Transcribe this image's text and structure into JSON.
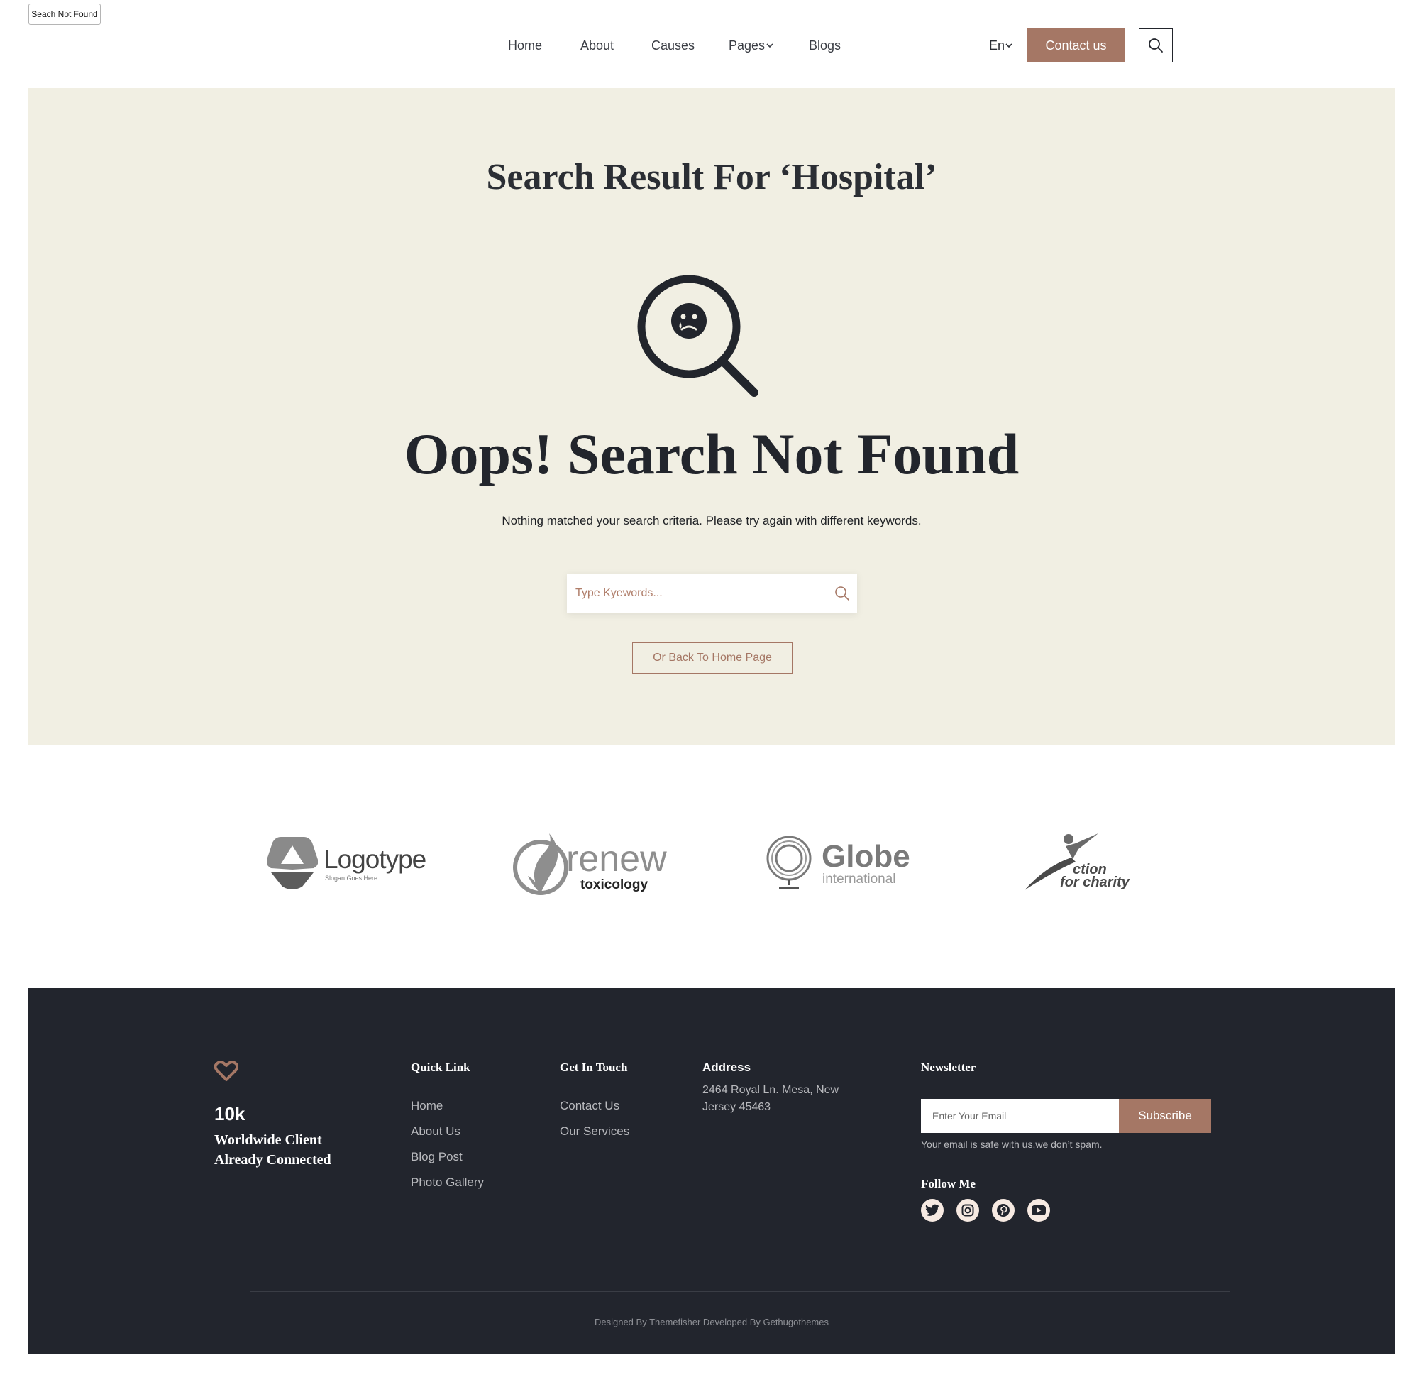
{
  "page_label": "Seach Not Found",
  "header": {
    "nav": [
      {
        "label": "Home"
      },
      {
        "label": "About"
      },
      {
        "label": "Causes"
      },
      {
        "label": "Pages"
      },
      {
        "label": "Blogs"
      }
    ],
    "language": "En",
    "contact_label": "Contact us"
  },
  "hero": {
    "title": "Search Result For ‘Hospital’",
    "heading": "Oops! Search Not Found",
    "text": "Nothing matched your search criteria. Please try again with different keywords.",
    "search_placeholder": "Type Kyewords...",
    "back_label": "Or Back To Home Page"
  },
  "logos": {
    "logotype": {
      "name": "Logotype",
      "slogan": "Slogan Goes Here"
    },
    "renew": {
      "name": "renew",
      "sub": "toxicology"
    },
    "globe": {
      "name": "Globe",
      "sub": "international"
    },
    "charity": {
      "line1": "ction",
      "line2": "for charity"
    }
  },
  "footer": {
    "count": "10k",
    "tagline": "Worldwide Client Already Connected",
    "quick_link": {
      "title": "Quick Link",
      "items": [
        {
          "label": "Home"
        },
        {
          "label": "About Us"
        },
        {
          "label": "Blog Post"
        },
        {
          "label": "Photo Gallery"
        }
      ]
    },
    "get_in_touch": {
      "title": "Get In Touch",
      "items": [
        {
          "label": "Contact Us"
        },
        {
          "label": "Our Services"
        }
      ]
    },
    "address": {
      "title": "Address",
      "text": "2464 Royal Ln. Mesa, New Jersey 45463"
    },
    "newsletter": {
      "title": "Newsletter",
      "placeholder": "Enter Your Email",
      "button": "Subscribe",
      "note": "Your email is safe with us,we don’t spam."
    },
    "follow_title": "Follow Me",
    "social": [
      "twitter-icon",
      "instagram-icon",
      "pinterest-icon",
      "youtube-icon"
    ],
    "copyright": "Designed By Themefisher Developed By Gethugothemes"
  },
  "colors": {
    "accent": "#a57765",
    "hero_bg": "#f1efe3",
    "footer_bg": "#22252d",
    "text_dark": "#22252c"
  }
}
